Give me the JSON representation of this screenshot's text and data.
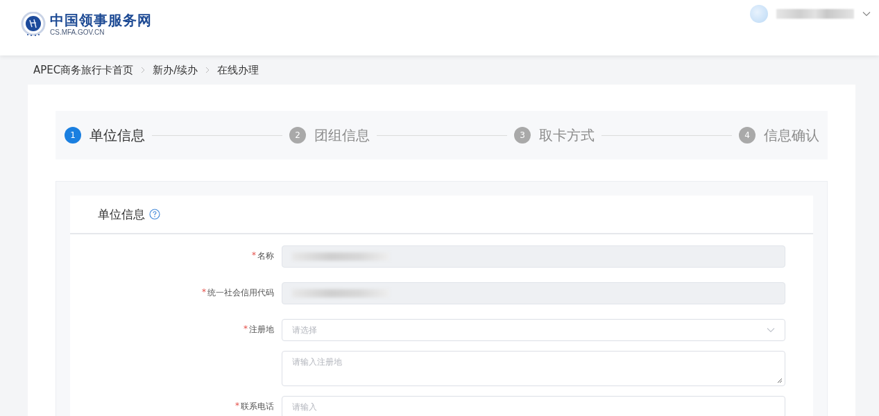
{
  "header": {
    "site_name": "中国领事服务网",
    "site_url": "CS.MFA.GOV.CN"
  },
  "breadcrumb": [
    "APEC商务旅行卡首页",
    "新办/续办",
    "在线办理"
  ],
  "steps": [
    {
      "number": "1",
      "label": "单位信息",
      "selected": true
    },
    {
      "number": "2",
      "label": "团组信息",
      "selected": false
    },
    {
      "number": "3",
      "label": "取卡方式",
      "selected": false
    },
    {
      "number": "4",
      "label": "信息确认",
      "selected": false
    }
  ],
  "section": {
    "title": "单位信息"
  },
  "fields": [
    {
      "kind": "text",
      "required_mark": "*",
      "label": "名称",
      "disabled": true,
      "redacted": true
    },
    {
      "kind": "text",
      "required_mark": "*",
      "label": "统一社会信用代码",
      "disabled": true,
      "redacted": true
    },
    {
      "kind": "select",
      "required_mark": "*",
      "label": "注册地",
      "placeholder": "请选择"
    },
    {
      "kind": "textarea",
      "placeholder": "请输入注册地"
    },
    {
      "kind": "text",
      "required_mark": "*",
      "label": "联系电话",
      "placeholder": "请输入"
    }
  ]
}
